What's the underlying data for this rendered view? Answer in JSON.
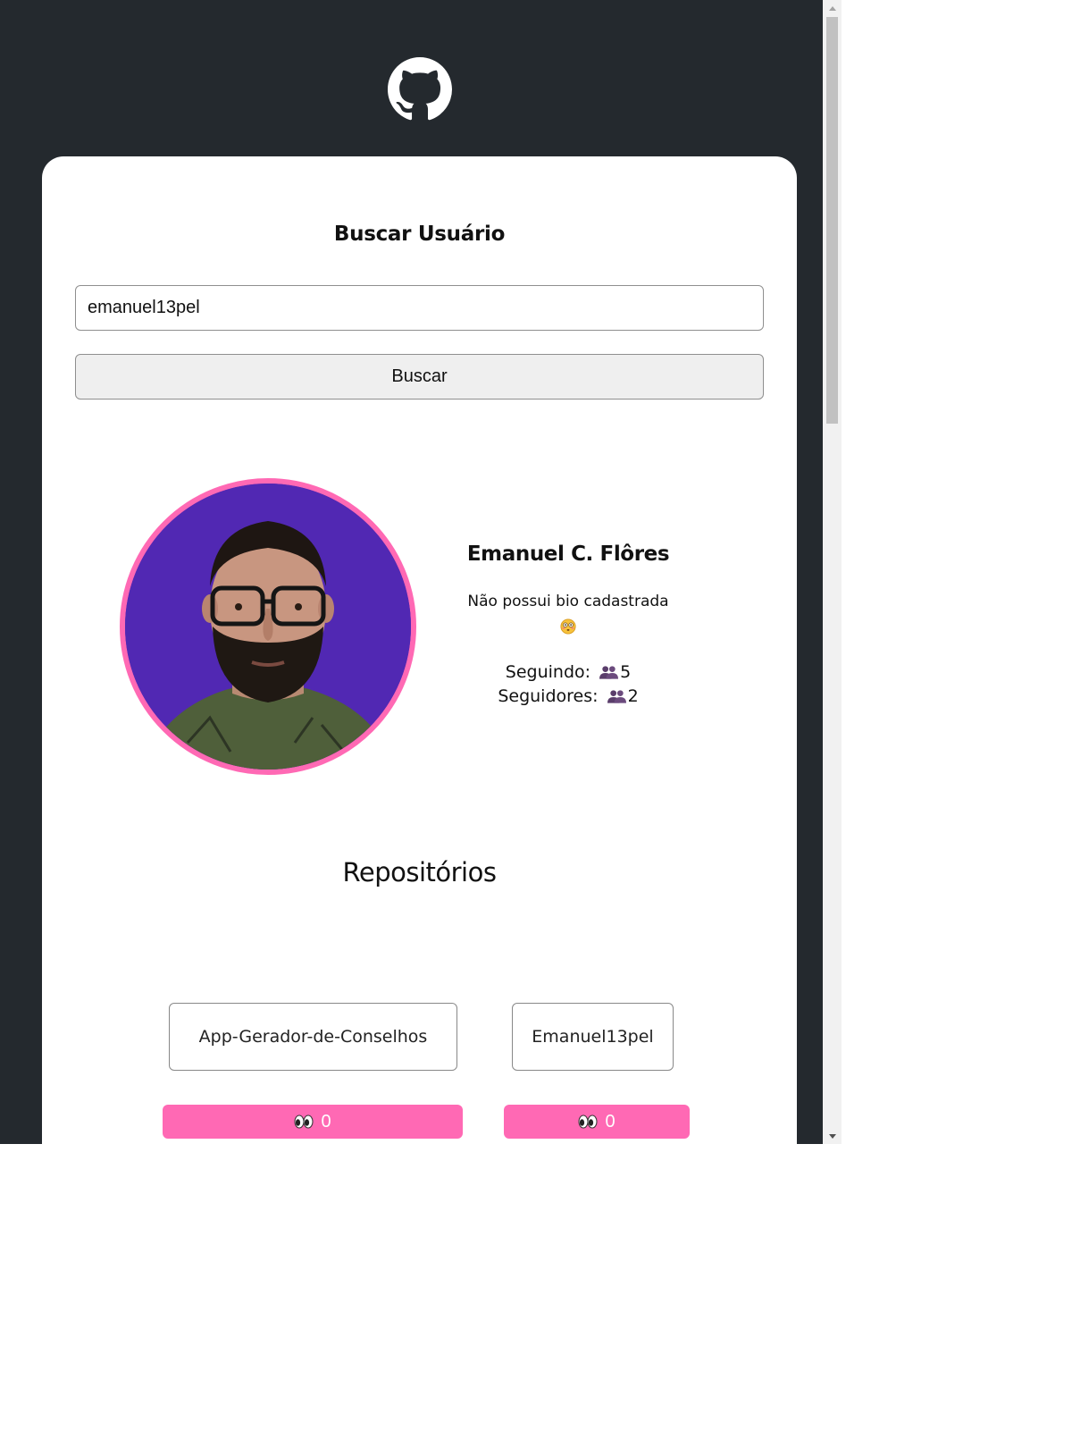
{
  "header": {
    "logo_icon": "github-octocat-icon"
  },
  "search": {
    "title": "Buscar Usuário",
    "input_value": "emanuel13pel",
    "button_label": "Buscar"
  },
  "profile": {
    "name": "Emanuel C. Flôres",
    "bio": "Não possui bio cadastrada",
    "bio_emoji_icon": "flushed-face-icon",
    "following_label": "Seguindo:",
    "following_count": "5",
    "followers_label": "Seguidores:",
    "followers_count": "2",
    "avatar_border_color": "#ff69b4",
    "avatar_bg_color": "#5128b3"
  },
  "repositories": {
    "title": "Repositórios",
    "items": [
      {
        "name": "App-Gerador-de-Conselhos",
        "watchers": "0"
      },
      {
        "name": "Emanuel13pel",
        "watchers": "0"
      }
    ]
  },
  "colors": {
    "page_background": "#24292e",
    "accent": "#ff69b4",
    "card_background": "#ffffff"
  }
}
